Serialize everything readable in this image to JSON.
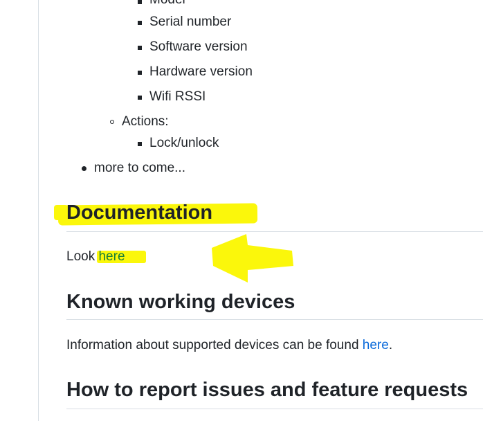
{
  "list": {
    "device_info_items": [
      "Model",
      "Serial number",
      "Software version",
      "Hardware version",
      "Wifi RSSI"
    ],
    "actions_label": "Actions:",
    "action_items": [
      "Lock/unlock"
    ],
    "more_item": "more to come..."
  },
  "documentation": {
    "heading": "Documentation",
    "look_prefix": "Look",
    "look_link": "here"
  },
  "known_devices": {
    "heading": "Known working devices",
    "text_prefix": "Information about supported devices can be found",
    "link": "here",
    "suffix": "."
  },
  "report": {
    "heading": "How to report issues and feature requests"
  },
  "colors": {
    "highlight": "#fbf70b",
    "link": "#0969da",
    "text": "#1f2328",
    "divider": "#d8dee4"
  }
}
